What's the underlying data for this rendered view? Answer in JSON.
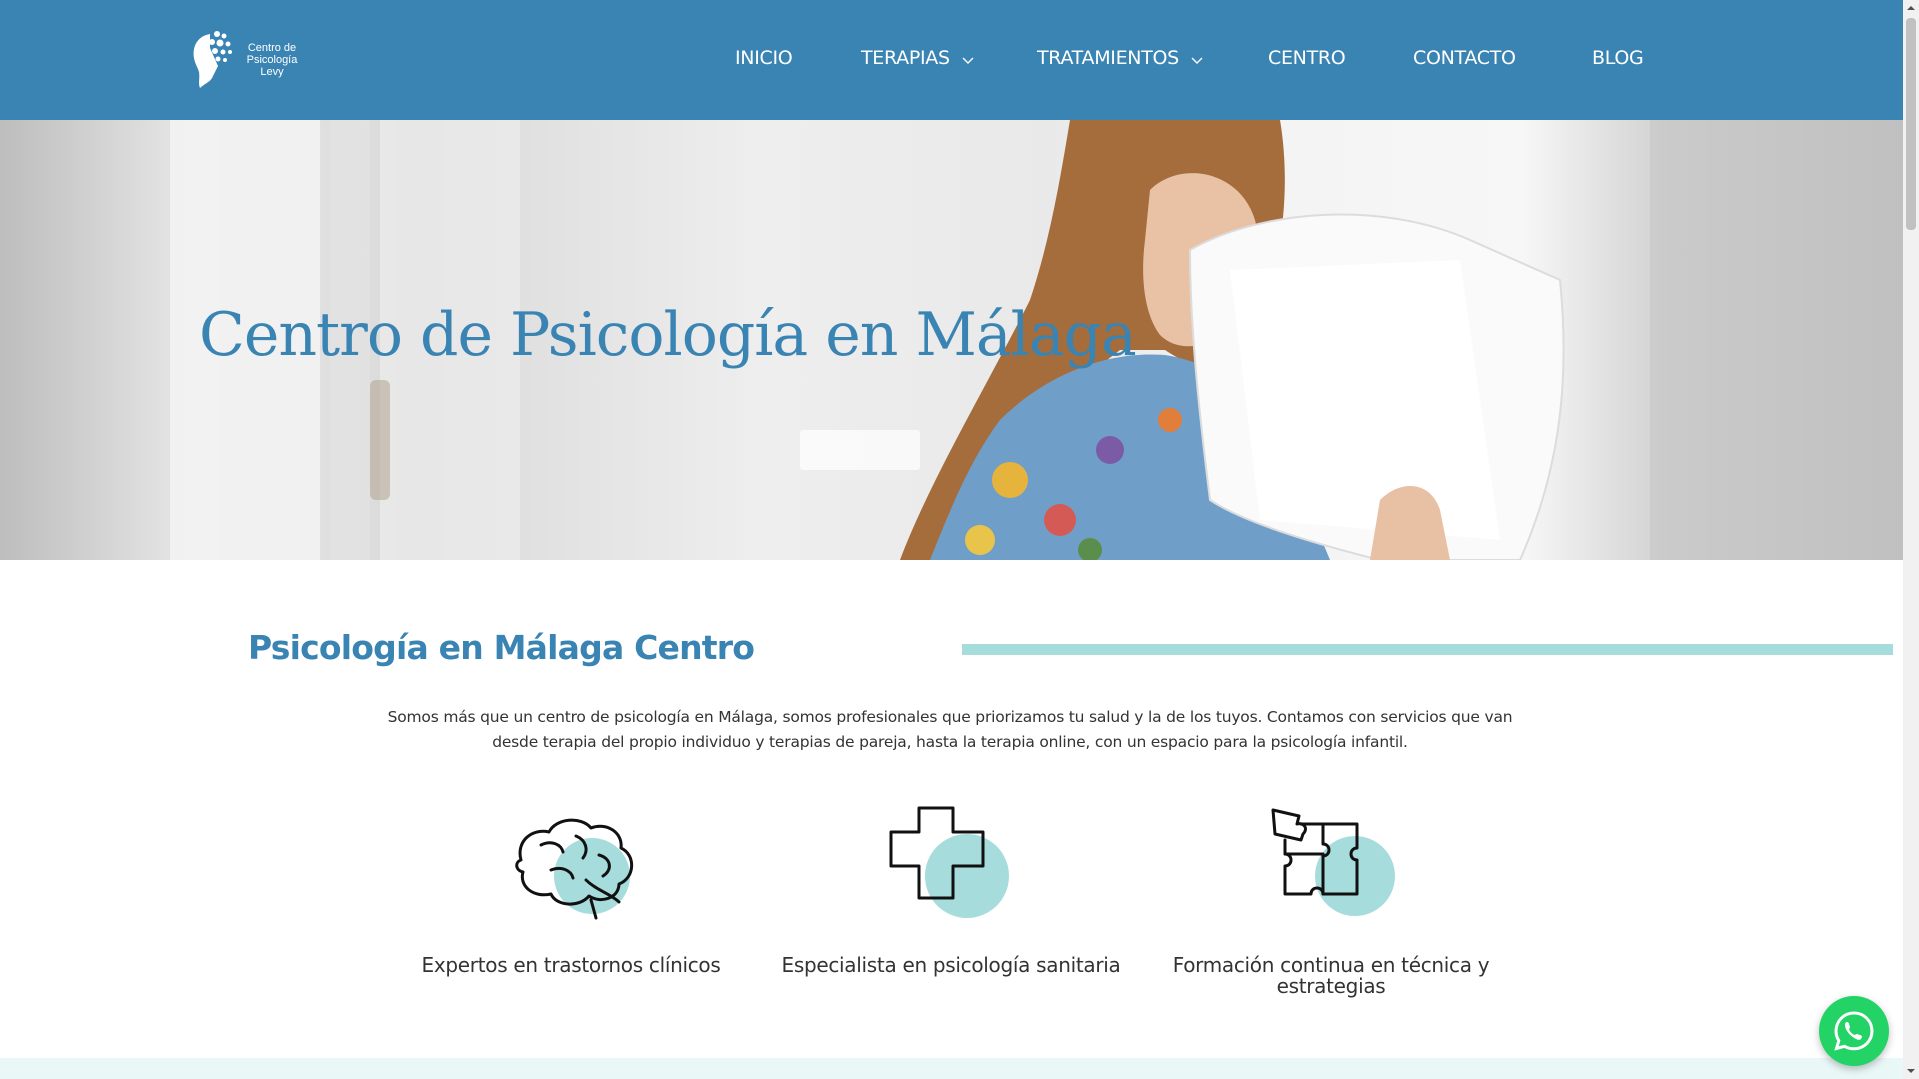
{
  "header": {
    "logo_text": "Centro de Psicología Levy",
    "nav": [
      {
        "label": "INICIO",
        "has_dropdown": false
      },
      {
        "label": "TERAPIAS",
        "has_dropdown": true
      },
      {
        "label": "TRATAMIENTOS",
        "has_dropdown": true
      },
      {
        "label": "CENTRO",
        "has_dropdown": false
      },
      {
        "label": "CONTACTO",
        "has_dropdown": false
      },
      {
        "label": "BLOG",
        "has_dropdown": false
      }
    ]
  },
  "hero": {
    "title": "Centro de Psicología en Málaga"
  },
  "section": {
    "title": "Psicología en Málaga Centro",
    "intro": "Somos más que un centro de psicología en Málaga, somos profesionales que priorizamos tu salud y la de los tuyos. Contamos con servicios que van desde terapia del propio individuo y terapias de pareja, hasta la terapia online, con un espacio para la psicología infantil."
  },
  "features": [
    {
      "icon": "brain-icon",
      "label": "Expertos en trastornos clínicos"
    },
    {
      "icon": "medical-cross-icon",
      "label": "Especialista en psicología sanitaria"
    },
    {
      "icon": "puzzle-icon",
      "label": "Formación continua en técnica y estrategias"
    }
  ],
  "colors": {
    "brand_blue": "#3a84b4",
    "accent_teal": "#a6dcdb",
    "whatsapp_green": "#23d366"
  }
}
